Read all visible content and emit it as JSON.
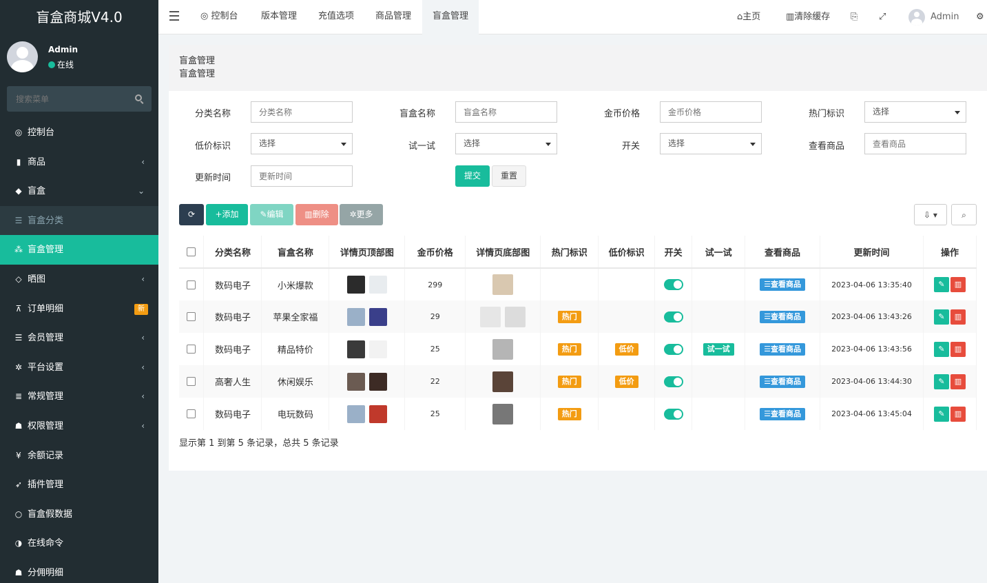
{
  "brand": "盲盒商城V4.0",
  "user": {
    "name": "Admin",
    "status": "在线"
  },
  "sidebar_search": {
    "placeholder": "搜索菜单"
  },
  "menu": [
    {
      "label": "控制台",
      "icon": "dashboard-icon",
      "glyph": "◎",
      "arrow": ""
    },
    {
      "label": "商品",
      "icon": "briefcase-icon",
      "glyph": "▮",
      "arrow": "‹"
    },
    {
      "label": "盲盒",
      "icon": "cube-icon",
      "glyph": "◆",
      "arrow": "⌄"
    },
    {
      "label": "盲盒分类",
      "icon": "list-icon",
      "glyph": "☰",
      "arrow": ""
    },
    {
      "label": "盲盒管理",
      "icon": "cubes-icon",
      "glyph": "⁂",
      "arrow": ""
    },
    {
      "label": "晒图",
      "icon": "gem-icon",
      "glyph": "◇",
      "arrow": "‹"
    },
    {
      "label": "订单明细",
      "icon": "cart-icon",
      "glyph": "⊼",
      "arrow": "",
      "badge": "新"
    },
    {
      "label": "会员管理",
      "icon": "list-icon",
      "glyph": "☰",
      "arrow": "‹"
    },
    {
      "label": "平台设置",
      "icon": "gear-icon",
      "glyph": "✲",
      "arrow": "‹"
    },
    {
      "label": "常规管理",
      "icon": "database-icon",
      "glyph": "≣",
      "arrow": "‹"
    },
    {
      "label": "权限管理",
      "icon": "group-icon",
      "glyph": "☗",
      "arrow": "‹"
    },
    {
      "label": "余额记录",
      "icon": "yen-icon",
      "glyph": "¥",
      "arrow": ""
    },
    {
      "label": "插件管理",
      "icon": "rocket-icon",
      "glyph": "➶",
      "arrow": ""
    },
    {
      "label": "盲盒假数据",
      "icon": "circle-icon",
      "glyph": "○",
      "arrow": ""
    },
    {
      "label": "在线命令",
      "icon": "half-circle-icon",
      "glyph": "◑",
      "arrow": ""
    },
    {
      "label": "分佣明细",
      "icon": "group-icon",
      "glyph": "☗",
      "arrow": ""
    }
  ],
  "topnav": {
    "tabs": [
      "控制台",
      "版本管理",
      "充值选项",
      "商品管理",
      "盲盒管理"
    ],
    "home": "主页",
    "clear_cache": "清除缓存",
    "user": "Admin"
  },
  "page": {
    "title": "盲盒管理",
    "subtitle": "盲盒管理"
  },
  "filters": {
    "category": {
      "label": "分类名称",
      "placeholder": "分类名称"
    },
    "name": {
      "label": "盲盒名称",
      "placeholder": "盲盒名称"
    },
    "price": {
      "label": "金币价格",
      "placeholder": "金币价格"
    },
    "hot": {
      "label": "热门标识",
      "value": "选择"
    },
    "low": {
      "label": "低价标识",
      "value": "选择"
    },
    "trial": {
      "label": "试一试",
      "value": "选择"
    },
    "switch": {
      "label": "开关",
      "value": "选择"
    },
    "view": {
      "label": "查看商品",
      "placeholder": "查看商品"
    },
    "updated": {
      "label": "更新时间",
      "placeholder": "更新时间"
    },
    "submit": "提交",
    "reset": "重置"
  },
  "toolbar": {
    "add": "添加",
    "edit": "编辑",
    "delete": "删除",
    "more": "更多"
  },
  "table": {
    "headers": [
      "分类名称",
      "盲盒名称",
      "详情页顶部图",
      "金币价格",
      "详情页底部图",
      "热门标识",
      "低价标识",
      "开关",
      "试一试",
      "查看商品",
      "更新时间",
      "操作"
    ],
    "view_label": "查看商品",
    "rows": [
      {
        "category": "数码电子",
        "name": "小米爆款",
        "price": "299",
        "hot": "",
        "low": "",
        "trial": "",
        "updated": "2023-04-06 13:35:40"
      },
      {
        "category": "数码电子",
        "name": "苹果全家福",
        "price": "29",
        "hot": "热门",
        "low": "",
        "trial": "",
        "updated": "2023-04-06 13:43:26"
      },
      {
        "category": "数码电子",
        "name": "精品特价",
        "price": "25",
        "hot": "热门",
        "low": "低价",
        "trial": "试一试",
        "updated": "2023-04-06 13:43:56"
      },
      {
        "category": "高奢人生",
        "name": "休闲娱乐",
        "price": "22",
        "hot": "热门",
        "low": "低价",
        "trial": "",
        "updated": "2023-04-06 13:44:30"
      },
      {
        "category": "数码电子",
        "name": "电玩数码",
        "price": "25",
        "hot": "热门",
        "low": "",
        "trial": "",
        "updated": "2023-04-06 13:45:04"
      }
    ]
  },
  "footer": "显示第 1 到第 5 条记录，总共 5 条记录",
  "colors": {
    "sidebar": "#222d32",
    "accent": "#18bc9c",
    "warning": "#f39c12",
    "info": "#3498db",
    "danger": "#e74c3c"
  }
}
